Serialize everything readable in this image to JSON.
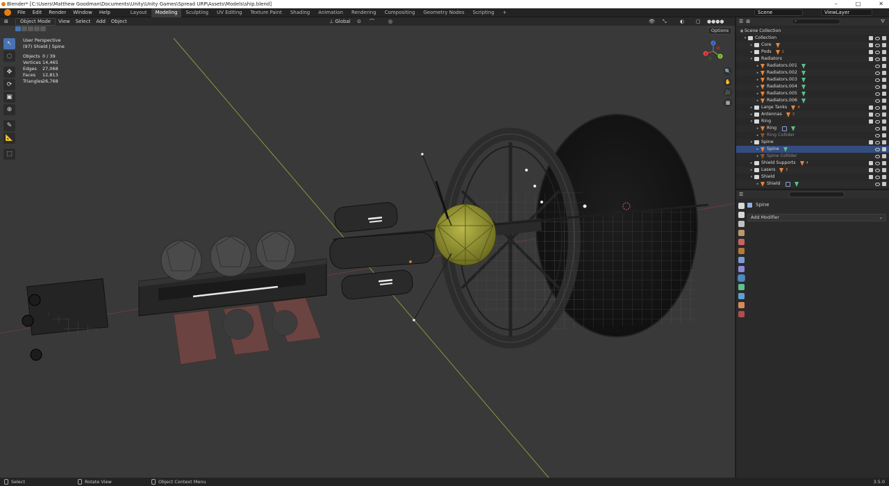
{
  "titlebar": {
    "title": "Blender* [C:\\Users\\Matthew Goodman\\Documents\\Unity\\Unity Games\\Spread URP\\Assets\\Models\\ship.blend]",
    "minimize": "–",
    "maximize": "□",
    "close": "✕"
  },
  "menubar": {
    "menus": [
      "File",
      "Edit",
      "Render",
      "Window",
      "Help"
    ],
    "workspaces": [
      "Layout",
      "Modeling",
      "Sculpting",
      "UV Editing",
      "Texture Paint",
      "Shading",
      "Animation",
      "Rendering",
      "Compositing",
      "Geometry Nodes",
      "Scripting"
    ],
    "active_workspace": "Modeling",
    "add_tab": "+",
    "scene": "Scene",
    "view_layer": "ViewLayer"
  },
  "viewport": {
    "mode": "Object Mode",
    "menus": [
      "View",
      "Select",
      "Add",
      "Object"
    ],
    "transform_orientation": "Global",
    "options": "Options",
    "perspective": "User Perspective",
    "active": "(97) Shield | Spine",
    "stats": [
      {
        "k": "Objects",
        "v": "0 / 39"
      },
      {
        "k": "Vertices",
        "v": "14,465"
      },
      {
        "k": "Edges",
        "v": "27,068"
      },
      {
        "k": "Faces",
        "v": "12,813"
      },
      {
        "k": "Triangles",
        "v": "26,768"
      }
    ],
    "tools": [
      "↖",
      "◌",
      "✥",
      "⟳",
      "▣",
      "⊕",
      "✎",
      "📐",
      "⬚"
    ],
    "gizmo_axes": [
      "X",
      "Y",
      "Z"
    ],
    "nav_buttons": [
      "🔍",
      "✋",
      "🎥",
      "▦"
    ]
  },
  "statusbar": {
    "select": "Select",
    "rotate": "Rotate View",
    "context": "Object Context Menu",
    "version": "3.5.0"
  },
  "outliner": {
    "root": "Scene Collection",
    "rows": [
      {
        "name": "Collection",
        "indent": 1,
        "type": "collection",
        "exp": "▾"
      },
      {
        "name": "Core",
        "indent": 2,
        "type": "collection",
        "exp": "▸",
        "mesh": true
      },
      {
        "name": "Pods",
        "indent": 2,
        "type": "collection",
        "exp": "▸",
        "mesh": true,
        "count": "2"
      },
      {
        "name": "Radiators",
        "indent": 2,
        "type": "collection",
        "exp": "▾"
      },
      {
        "name": "Radiators.001",
        "indent": 3,
        "type": "object",
        "exp": "▸",
        "data": true
      },
      {
        "name": "Radiators.002",
        "indent": 3,
        "type": "object",
        "exp": "▸",
        "data": true
      },
      {
        "name": "Radiators.003",
        "indent": 3,
        "type": "object",
        "exp": "▸",
        "data": true
      },
      {
        "name": "Radiators.004",
        "indent": 3,
        "type": "object",
        "exp": "▸",
        "data": true
      },
      {
        "name": "Radiators.005",
        "indent": 3,
        "type": "object",
        "exp": "▸",
        "data": true
      },
      {
        "name": "Radiators.006",
        "indent": 3,
        "type": "object",
        "exp": "▸",
        "data": true
      },
      {
        "name": "Large Tanks",
        "indent": 2,
        "type": "collection",
        "exp": "▸",
        "mesh": true,
        "count": "4"
      },
      {
        "name": "Antennas",
        "indent": 2,
        "type": "collection",
        "exp": "▸",
        "mesh": true,
        "count": "3"
      },
      {
        "name": "Ring",
        "indent": 2,
        "type": "collection",
        "exp": "▾"
      },
      {
        "name": "Ring",
        "indent": 3,
        "type": "object",
        "exp": "▸",
        "mod": true,
        "data": true
      },
      {
        "name": "Ring Collider",
        "indent": 3,
        "type": "object",
        "exp": "▸",
        "dim": true
      },
      {
        "name": "Spine",
        "indent": 2,
        "type": "collection",
        "exp": "▾"
      },
      {
        "name": "Spine",
        "indent": 3,
        "type": "object",
        "exp": "▸",
        "data": true,
        "selected": true
      },
      {
        "name": "Spine Collider",
        "indent": 3,
        "type": "object",
        "exp": "▸",
        "dim": true
      },
      {
        "name": "Shield Supports",
        "indent": 2,
        "type": "collection",
        "exp": "▸",
        "mesh": true,
        "count": "4"
      },
      {
        "name": "Lasers",
        "indent": 2,
        "type": "collection",
        "exp": "▸",
        "mesh": true,
        "count": "5"
      },
      {
        "name": "Shield",
        "indent": 2,
        "type": "collection",
        "exp": "▾"
      },
      {
        "name": "Shield",
        "indent": 3,
        "type": "object",
        "exp": "▸",
        "mod": true,
        "data": true
      }
    ]
  },
  "properties": {
    "object_name": "Spine",
    "add_modifier": "Add Modifier",
    "tab_colors": [
      "#d8d8d8",
      "#d8d8d8",
      "#c0c0c0",
      "#b99a6a",
      "#c46464",
      "#b37a3b",
      "#7b9bd6",
      "#8b8bd6",
      "#4b8bbd",
      "#5cc08f",
      "#5fa0d6",
      "#d68a5c",
      "#b04d4d"
    ]
  }
}
